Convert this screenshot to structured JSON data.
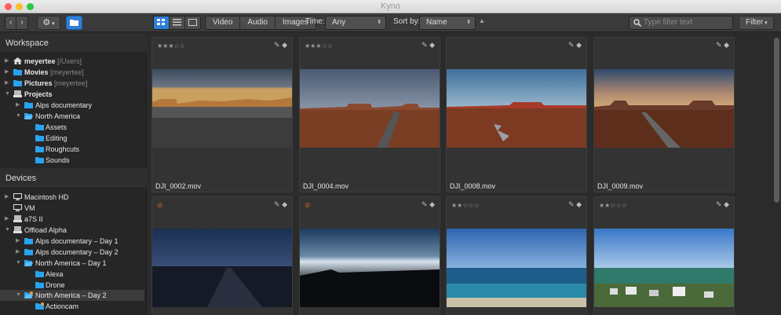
{
  "window": {
    "title": "Kyno"
  },
  "toolbar": {
    "filters": [
      "Video",
      "Audio",
      "Images"
    ],
    "time_label": "Time:",
    "time_value": "Any",
    "sort_label": "Sort by:",
    "sort_value": "Name",
    "search_placeholder": "Type filter text",
    "filter_button": "Filter"
  },
  "sidebar": {
    "workspace_title": "Workspace",
    "workspace_items": [
      {
        "label": "meyertee",
        "suffix": "[/Users]"
      },
      {
        "label": "Movies",
        "suffix": "[meyertee]"
      },
      {
        "label": "Pictures",
        "suffix": "[meyertee]"
      },
      {
        "label": "Projects",
        "suffix": ""
      },
      {
        "label": "Alps documentary",
        "suffix": ""
      },
      {
        "label": "North America",
        "suffix": ""
      },
      {
        "label": "Assets",
        "suffix": ""
      },
      {
        "label": "Editing",
        "suffix": ""
      },
      {
        "label": "Roughcuts",
        "suffix": ""
      },
      {
        "label": "Sounds",
        "suffix": ""
      }
    ],
    "devices_title": "Devices",
    "device_items": [
      {
        "label": "Macintosh HD"
      },
      {
        "label": "VM"
      },
      {
        "label": "a7S II"
      },
      {
        "label": "Offload Alpha"
      },
      {
        "label": "Alps documentary – Day 1"
      },
      {
        "label": "Alps documentary – Day 2"
      },
      {
        "label": "North America – Day 1"
      },
      {
        "label": "Alexa"
      },
      {
        "label": "Drone"
      },
      {
        "label": "North America – Day 2"
      },
      {
        "label": "Actioncam"
      }
    ]
  },
  "grid": {
    "items": [
      {
        "filename": "DJI_0002.mov",
        "rating": 3,
        "stars": "★★★☆☆"
      },
      {
        "filename": "DJI_0004.mov",
        "rating": 3,
        "stars": "★★★☆☆"
      },
      {
        "filename": "DJI_0008.mov",
        "rating": 0,
        "stars": ""
      },
      {
        "filename": "DJI_0009.mov",
        "rating": 0,
        "stars": ""
      },
      {
        "filename": "",
        "rating": 0,
        "stars": "",
        "marker": "⊘"
      },
      {
        "filename": "",
        "rating": 0,
        "stars": "",
        "marker": "⊘"
      },
      {
        "filename": "",
        "rating": 2,
        "stars": "★★☆☆☆"
      },
      {
        "filename": "",
        "rating": 2,
        "stars": "★★☆☆☆"
      }
    ]
  },
  "colors": {
    "accent": "#2f7fd8",
    "folder": "#2aa3ef",
    "marker": "#c8642a"
  }
}
